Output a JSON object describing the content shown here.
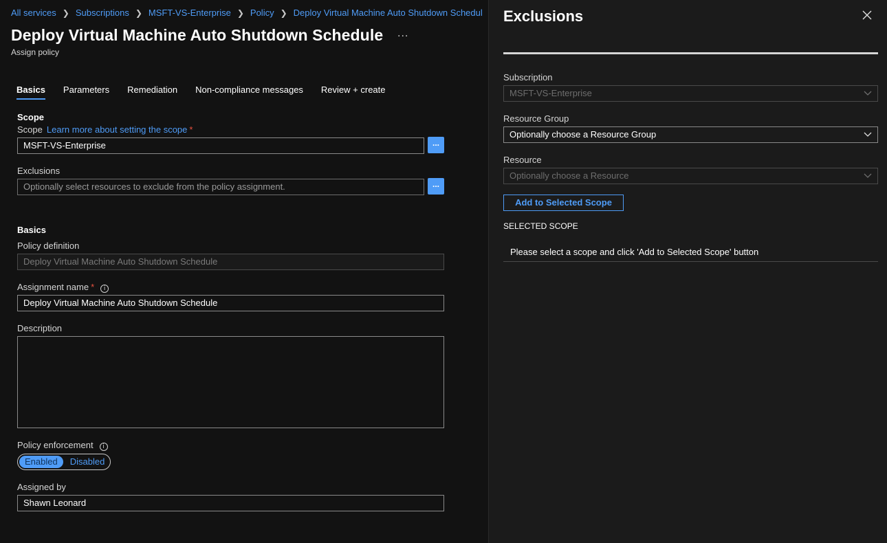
{
  "breadcrumb": [
    "All services",
    "Subscriptions",
    "MSFT-VS-Enterprise",
    "Policy",
    "Deploy Virtual Machine Auto Shutdown Schedul"
  ],
  "page": {
    "title": "Deploy Virtual Machine Auto Shutdown Schedule",
    "more": "...",
    "subtitle": "Assign policy"
  },
  "tabs": [
    "Basics",
    "Parameters",
    "Remediation",
    "Non-compliance messages",
    "Review + create"
  ],
  "scope_section": {
    "heading": "Scope",
    "scope_label": "Scope",
    "scope_link": "Learn more about setting the scope",
    "scope_value": "MSFT-VS-Enterprise",
    "exclusions_label": "Exclusions",
    "exclusions_placeholder": "Optionally select resources to exclude from the policy assignment.",
    "browse": "..."
  },
  "basics_section": {
    "heading": "Basics",
    "policy_definition_label": "Policy definition",
    "policy_definition_value": "Deploy Virtual Machine Auto Shutdown Schedule",
    "assignment_name_label": "Assignment name",
    "assignment_name_value": "Deploy Virtual Machine Auto Shutdown Schedule",
    "description_label": "Description",
    "enforcement_label": "Policy enforcement",
    "enforcement_on": "Enabled",
    "enforcement_off": "Disabled",
    "assigned_by_label": "Assigned by",
    "assigned_by_value": "Shawn Leonard"
  },
  "panel": {
    "title": "Exclusions",
    "subscription_label": "Subscription",
    "subscription_value": "MSFT-VS-Enterprise",
    "resource_group_label": "Resource Group",
    "resource_group_value": "Optionally choose a Resource Group",
    "resource_label": "Resource",
    "resource_value": "Optionally choose a Resource",
    "add_button": "Add to Selected Scope",
    "selected_scope_heading": "SELECTED SCOPE",
    "selected_scope_message": "Please select a scope and click 'Add to Selected Scope' button"
  },
  "colors": {
    "accent": "#4f9cf7",
    "required": "#e8523f",
    "background": "#121212",
    "panel_background": "#1b1b1b"
  },
  "icons": {
    "close": "close-icon",
    "chevron": "chevron-down-icon",
    "info": "info-icon"
  }
}
